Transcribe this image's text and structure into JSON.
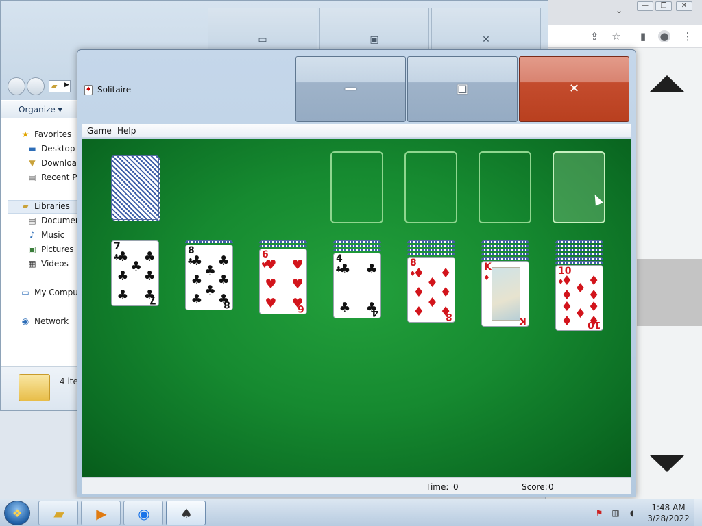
{
  "chrome": {
    "icons": [
      "share-icon",
      "star-icon",
      "sidebar-icon",
      "profile-icon",
      "menu-icon"
    ],
    "window_buttons": [
      "minimize-icon",
      "restore-icon",
      "close-icon"
    ]
  },
  "explorer": {
    "organize_label": "Organize",
    "favorites_label": "Favorites",
    "favorites": [
      "Desktop",
      "Download",
      "Recent Pla"
    ],
    "libraries_label": "Libraries",
    "libraries": [
      "Documen",
      "Music",
      "Pictures",
      "Videos"
    ],
    "computer_label": "My Comput",
    "network_label": "Network",
    "item_count": "4 ite"
  },
  "solitaire": {
    "title": "Solitaire",
    "menu": [
      "Game",
      "Help"
    ],
    "status": {
      "time_label": "Time:",
      "time_value": "0",
      "score_label": "Score:",
      "score_value": "0"
    },
    "tableau": [
      {
        "rank": "7",
        "suit": "♣",
        "color": "blk",
        "hidden": 0
      },
      {
        "rank": "8",
        "suit": "♣",
        "color": "blk",
        "hidden": 1
      },
      {
        "rank": "6",
        "suit": "♥",
        "color": "red",
        "hidden": 2
      },
      {
        "rank": "4",
        "suit": "♣",
        "color": "blk",
        "hidden": 3
      },
      {
        "rank": "8",
        "suit": "♦",
        "color": "red",
        "hidden": 4
      },
      {
        "rank": "K",
        "suit": "♦",
        "color": "red",
        "hidden": 5
      },
      {
        "rank": "10",
        "suit": "♦",
        "color": "red",
        "hidden": 6
      }
    ],
    "foundations": 4
  },
  "taskbar": {
    "buttons": [
      "windows-explorer-icon",
      "media-player-icon",
      "chrome-icon",
      "solitaire-icon"
    ],
    "clock_time": "1:48 AM",
    "clock_date": "3/28/2022"
  },
  "colors": {
    "felt": "#168a30",
    "close_button": "#c44c2e",
    "card_red": "#d2141b"
  }
}
